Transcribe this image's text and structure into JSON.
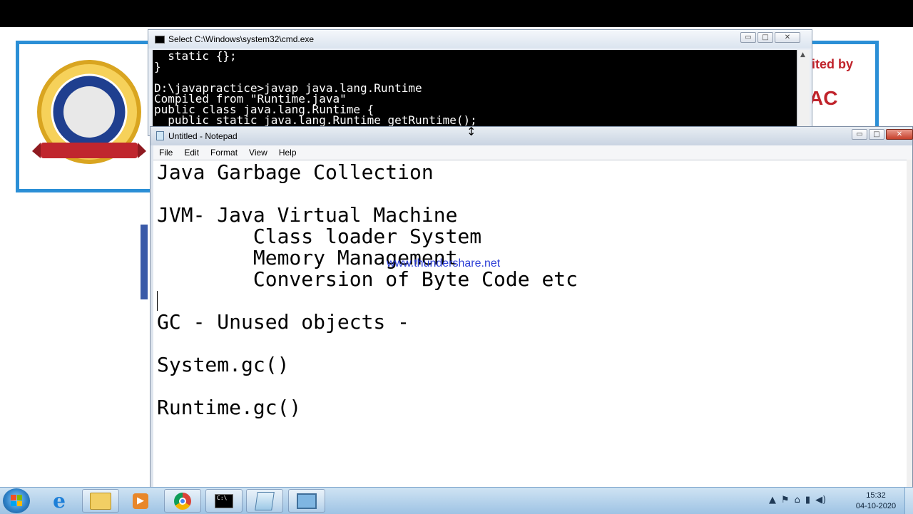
{
  "cmd": {
    "title": "Select C:\\Windows\\system32\\cmd.exe",
    "lines": [
      "  static {};",
      "}",
      "",
      "D:\\javapractice>javap java.lang.Runtime",
      "Compiled from \"Runtime.java\"",
      "public class java.lang.Runtime {",
      "  public static java.lang.Runtime getRuntime();"
    ]
  },
  "notepad": {
    "title": "Untitled - Notepad",
    "menu": [
      "File",
      "Edit",
      "Format",
      "View",
      "Help"
    ],
    "lines": [
      "Java Garbage Collection",
      "",
      "JVM- Java Virtual Machine",
      "        Class loader System",
      "        Memory Management",
      "        Conversion of Byte Code etc",
      "",
      "GC - Unused objects -",
      "",
      "System.gc()",
      "",
      "Runtime.gc()"
    ]
  },
  "overlay": {
    "watermark": "www.thundershare.net"
  },
  "desktop": {
    "naac_partial": "ited by",
    "naac_logo": "AC"
  },
  "window_buttons": {
    "minimize": "▭",
    "maximize": "□",
    "close": "✕"
  },
  "taskbar": {
    "tray_icons": [
      "up-arrow-icon",
      "flag-icon",
      "network-icon",
      "signal-icon",
      "volume-icon"
    ],
    "tray_glyphs": [
      "▲",
      "⚑",
      "⌂",
      "▮",
      "◀)"
    ],
    "time": "15:32",
    "date": "04-10-2020"
  }
}
